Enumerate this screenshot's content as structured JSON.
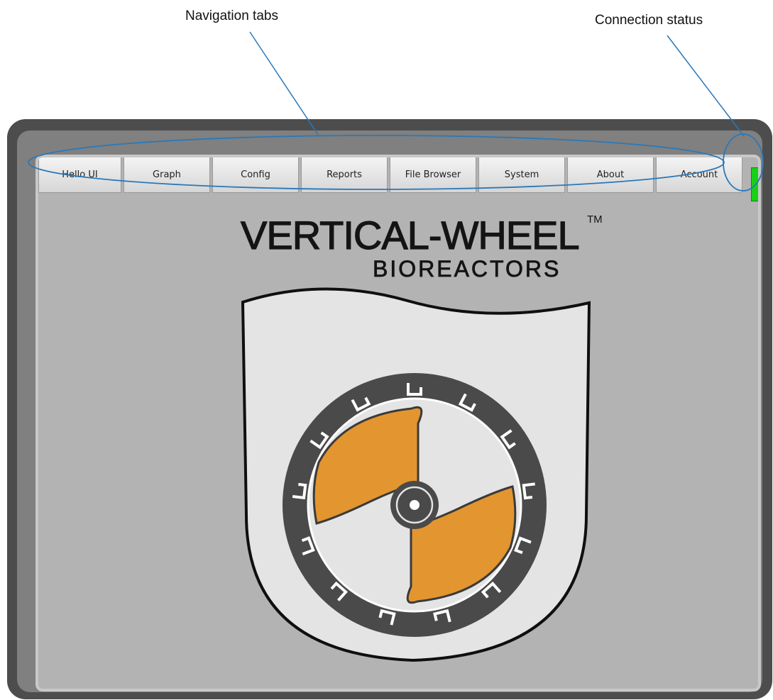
{
  "annotations": {
    "navigation_tabs": "Navigation tabs",
    "connection_status": "Connection status"
  },
  "tabs": [
    {
      "label": "Hello UI"
    },
    {
      "label": "Graph"
    },
    {
      "label": "Config"
    },
    {
      "label": "Reports"
    },
    {
      "label": "File Browser"
    },
    {
      "label": "System"
    },
    {
      "label": "About"
    },
    {
      "label": "Account"
    }
  ],
  "connection": {
    "status_color": "#17d117"
  },
  "logo": {
    "title": "VERTICAL-WHEEL",
    "trademark": "TM",
    "subtitle": "BIOREACTORS"
  },
  "colors": {
    "frame": "#4d4d4d",
    "screen": "#b3b3b3",
    "accent": "#e39530",
    "annotation_line": "#2a78b8"
  }
}
